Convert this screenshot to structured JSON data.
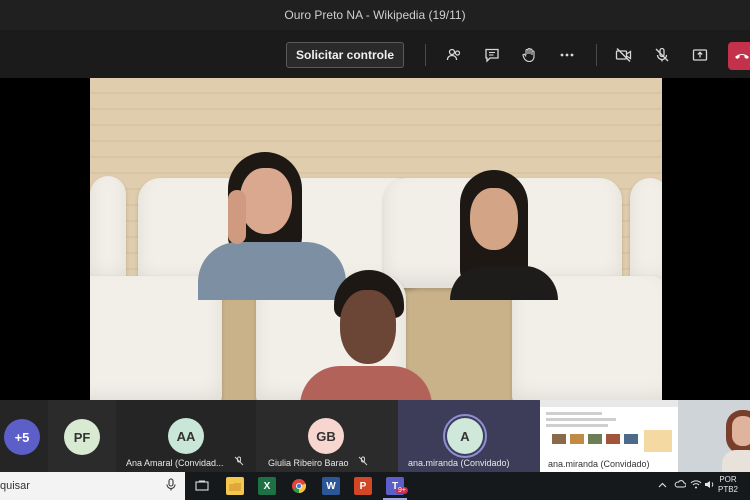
{
  "window": {
    "title": "Ouro Preto NA - Wikipedia (19/11)",
    "controls": {
      "minimize": "—",
      "maximize": "☐",
      "close": "✕"
    }
  },
  "toolbar": {
    "request_control_label": "Solicitar controle",
    "icons": [
      "participants-icon",
      "chat-icon",
      "raise-hand-icon",
      "more-icon",
      "camera-off-icon",
      "mic-off-icon",
      "share-icon",
      "leave-call-icon"
    ]
  },
  "participants": [
    {
      "initials": "+5",
      "color": "#5b5fc7"
    },
    {
      "initials": "PF",
      "color": "#d9ead3"
    },
    {
      "initials": "AA",
      "name": "Ana Amaral (Convidad...",
      "color": "#c9e7d8",
      "muted": true
    },
    {
      "initials": "GB",
      "name": "Giulia Ribeiro Barao",
      "color": "#f7d6cf",
      "muted": true
    },
    {
      "initials": "A",
      "name": "ana.miranda (Convidado)",
      "color": "#cfe8d9",
      "speaking": true
    }
  ],
  "screen_share": {
    "name": "ana.miranda (Convidado)"
  },
  "taskbar": {
    "search_text": "quisar",
    "apps": [
      {
        "name": "task-view-icon",
        "label": "⧉",
        "color": "#15191c"
      },
      {
        "name": "file-explorer-icon",
        "label": "",
        "color": "#f2c94c"
      },
      {
        "name": "excel-icon",
        "label": "X",
        "color": "#1e7145"
      },
      {
        "name": "chrome-icon",
        "label": "",
        "color": "#e0443e"
      },
      {
        "name": "word-icon",
        "label": "W",
        "color": "#2b5797"
      },
      {
        "name": "powerpoint-icon",
        "label": "P",
        "color": "#d24726"
      },
      {
        "name": "teams-icon",
        "label": "T",
        "color": "#5b5fc7"
      }
    ],
    "lang_top": "POR",
    "lang_bottom": "PTB2",
    "teams_badge": "9+"
  }
}
